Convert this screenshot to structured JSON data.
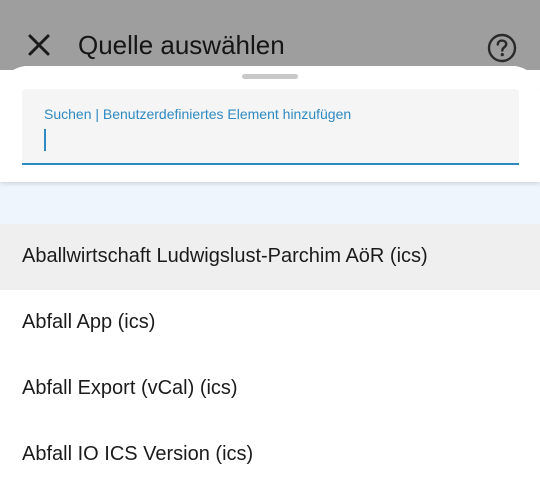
{
  "header": {
    "title": "Quelle auswählen",
    "close_icon": "close-icon",
    "help_icon": "help-circle-icon"
  },
  "search": {
    "label": "Suchen | Benutzerdefiniertes Element hinzufügen",
    "value": ""
  },
  "list": {
    "items": [
      {
        "label": "Aballwirtschaft Ludwigslust-Parchim AöR (ics)"
      },
      {
        "label": "Abfall App (ics)"
      },
      {
        "label": "Abfall Export (vCal) (ics)"
      },
      {
        "label": "Abfall IO ICS Version (ics)"
      }
    ]
  },
  "colors": {
    "accent": "#2f8ac4",
    "header_dim": "#9e9e9e",
    "highlight_row": "#efefef",
    "spacer_row": "#eef5fd"
  }
}
